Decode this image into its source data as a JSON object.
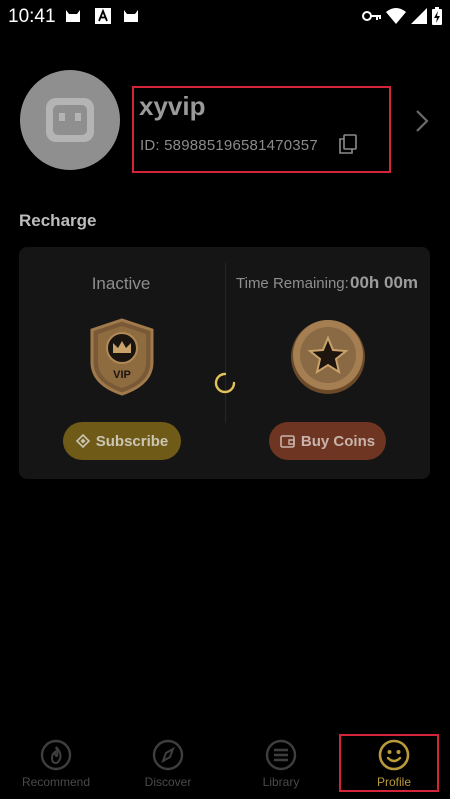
{
  "status_bar": {
    "time": "10:41",
    "icons": [
      "cat-icon",
      "a-badge-icon",
      "cat-icon",
      "key-icon",
      "wifi-icon",
      "signal-icon",
      "battery-charging-icon"
    ]
  },
  "profile": {
    "username": "xyvip",
    "id_text": "ID: 589885196581470357",
    "avatar_icon": "robot-face-icon"
  },
  "recharge": {
    "section_title": "Recharge",
    "vip_status": "Inactive",
    "vip_badge_text": "VIP",
    "time_remaining_label": "Time Remaining:",
    "time_remaining_value": "00h 00m",
    "subscribe_label": "Subscribe",
    "buy_coins_label": "Buy Coins"
  },
  "nav": {
    "items": [
      {
        "label": "Recommend",
        "icon": "flame-icon"
      },
      {
        "label": "Discover",
        "icon": "compass-icon"
      },
      {
        "label": "Library",
        "icon": "list-icon"
      },
      {
        "label": "Profile",
        "icon": "smiley-icon"
      }
    ],
    "active": "Profile"
  },
  "colors": {
    "accent_gold": "#b89a3a",
    "highlight_red": "#d3243a",
    "subscribe_bg": "#6f5b17",
    "buy_coins_bg": "#6e3622"
  }
}
